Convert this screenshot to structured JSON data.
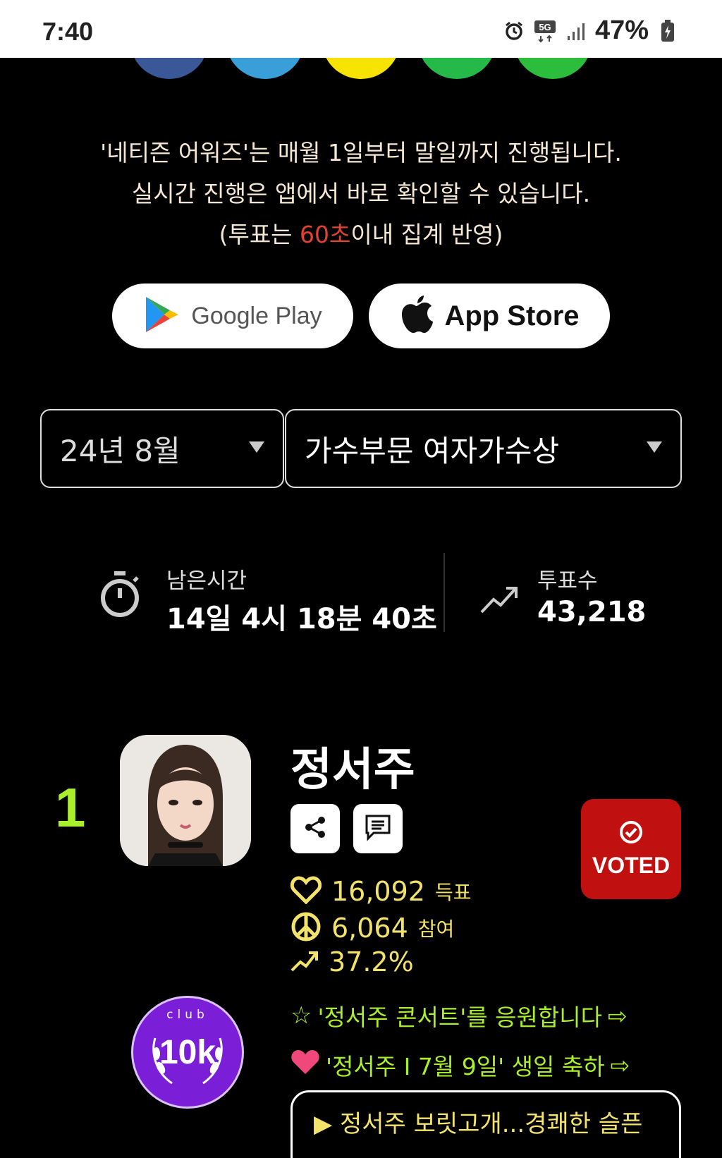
{
  "status_bar": {
    "time": "7:40",
    "network": "5G",
    "battery": "47%",
    "icons": [
      "alarm-icon",
      "5g-icon",
      "signal-icon",
      "battery-icon"
    ]
  },
  "notice": {
    "line1": "'네티즌 어워즈'는 매월 1일부터 말일까지 진행됩니다.",
    "line2": "실시간 진행은 앱에서 바로 확인할 수 있습니다.",
    "line3_prefix": "(투표는 ",
    "line3_highlight": "60초",
    "line3_suffix": "이내 집계 반영)",
    "highlight_color": "#e2432f"
  },
  "store_buttons": {
    "google": "Google Play",
    "apple": "App Store"
  },
  "filters": {
    "month": "24년 8월",
    "category": "가수부문 여자가수상"
  },
  "stats": {
    "time_label": "남은시간",
    "time_value": "14일 4시 18분 40초",
    "votes_label": "투표수",
    "votes_value": "43,218"
  },
  "entry": {
    "rank": "1",
    "name": "정서주",
    "voted_label": "VOTED",
    "votes": "16,092",
    "votes_unit": "득표",
    "participants": "6,064",
    "participants_unit": "참여",
    "percent": "37.2%",
    "badge_club": "club",
    "badge_value": "10k",
    "link1": "'정서주 콘서트'를 응원합니다",
    "link2": "'정서주 I 7월 9일' 생일 축하",
    "link_arrow": "⇨",
    "box_text": "▶ 정서주 보릿고개...경쾌한 슬픈"
  },
  "colors": {
    "accent_green": "#a9ef2b",
    "accent_yellow": "#f3e36a",
    "voted_red": "#c11010"
  }
}
